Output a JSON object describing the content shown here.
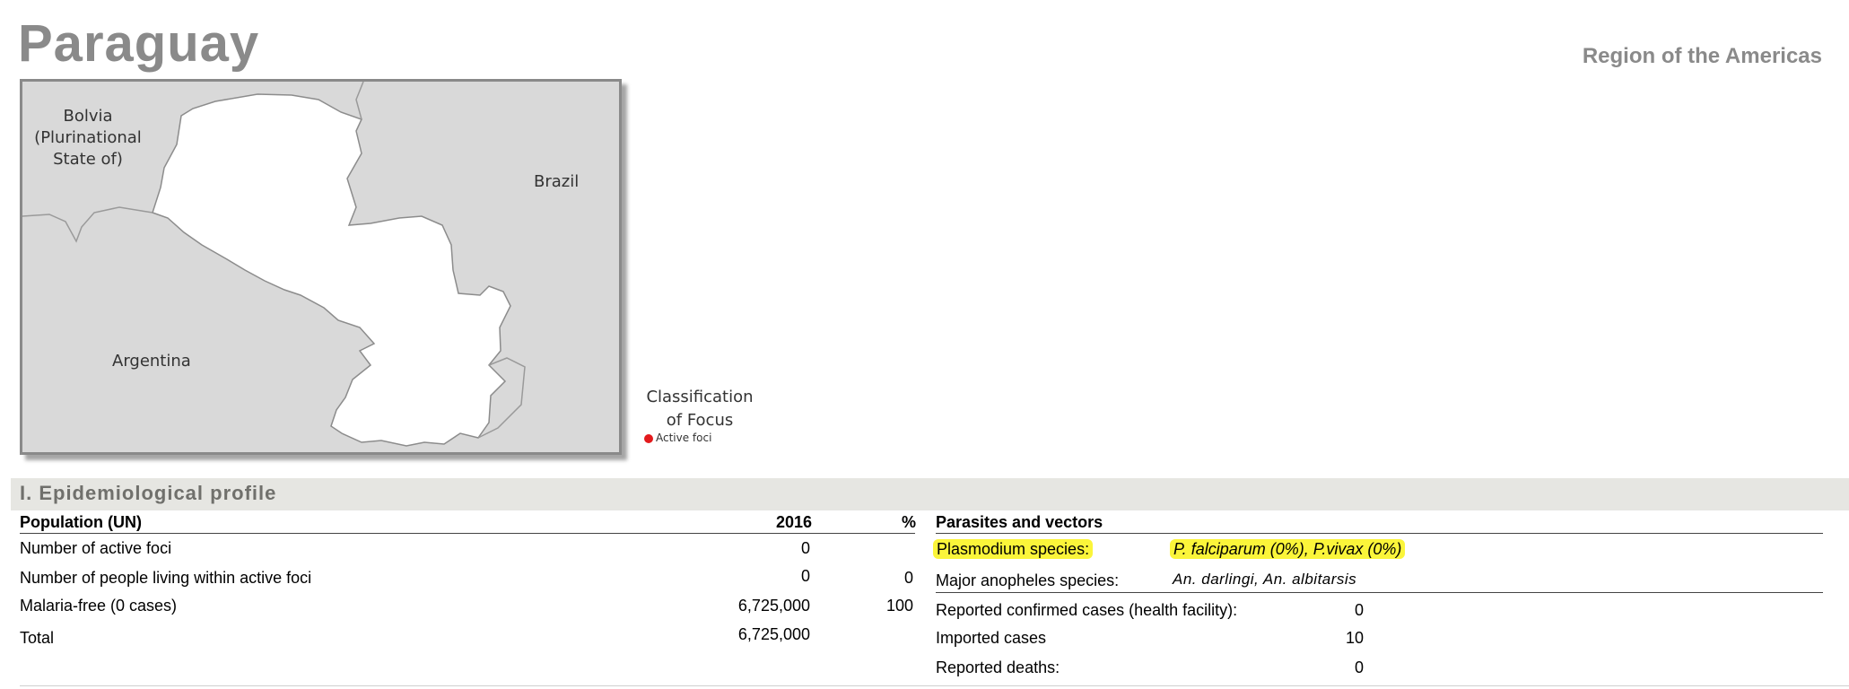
{
  "header": {
    "country": "Paraguay",
    "region": "Region of the Americas"
  },
  "map": {
    "labels": {
      "bolivia": [
        "Bolvia",
        "(Plurinational",
        "State of)"
      ],
      "brazil": "Brazil",
      "argentina": "Argentina"
    },
    "legend": {
      "title_line1": "Classification",
      "title_line2": "of Focus",
      "item": "Active foci",
      "item_color": "#e31a1c"
    }
  },
  "section": {
    "title": "I. Epidemiological profile"
  },
  "population_table": {
    "header": {
      "label": "Population (UN)",
      "year": "2016",
      "pct": "%"
    },
    "rows": [
      {
        "label": "Number of active foci",
        "value": "0",
        "pct": ""
      },
      {
        "label": "Number of people living within active foci",
        "value": "0",
        "pct": "0"
      },
      {
        "label": "Malaria-free (0 cases)",
        "value": "6,725,000",
        "pct": "100"
      },
      {
        "label": "Total",
        "value": "6,725,000",
        "pct": ""
      }
    ]
  },
  "parasites": {
    "header": "Parasites and vectors",
    "plasmodium_label": "Plasmodium species:",
    "plasmodium_value": "P. falciparum (0%), P.vivax (0%)",
    "anopheles_label": "Major anopheles species:",
    "anopheles_value": "An. darlingi, An. albitarsis",
    "highlight_color": "#fbf53a"
  },
  "cases": [
    {
      "label": "Reported confirmed cases (health facility):",
      "value": "0"
    },
    {
      "label": "Imported cases",
      "value": "10"
    },
    {
      "label": "Reported deaths:",
      "value": "0"
    }
  ]
}
